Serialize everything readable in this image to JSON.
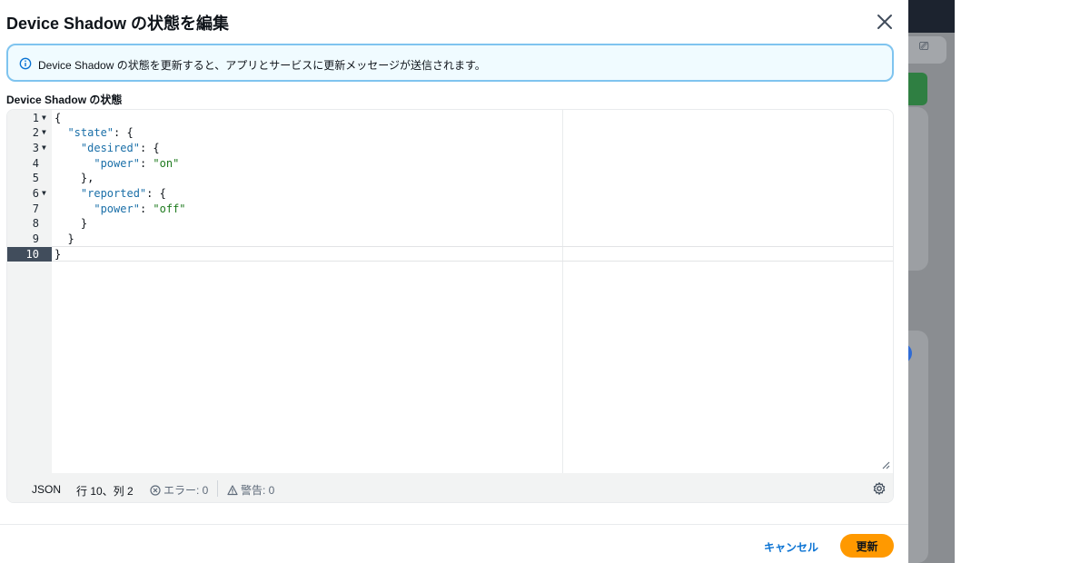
{
  "modal": {
    "title": "Device Shadow の状態を編集",
    "close_icon": "close-icon"
  },
  "alert": {
    "icon": "info-icon",
    "text": "Device Shadow の状態を更新すると、アプリとサービスに更新メッセージが送信されます。"
  },
  "editor": {
    "label": "Device Shadow の状態",
    "active_line": 10,
    "lines": [
      {
        "num": "1",
        "fold": true,
        "parts": [
          {
            "t": "{",
            "c": "punct"
          }
        ]
      },
      {
        "num": "2",
        "fold": true,
        "parts": [
          {
            "t": "  ",
            "c": "punct"
          },
          {
            "t": "\"state\"",
            "c": "key"
          },
          {
            "t": ": {",
            "c": "punct"
          }
        ]
      },
      {
        "num": "3",
        "fold": true,
        "parts": [
          {
            "t": "    ",
            "c": "punct"
          },
          {
            "t": "\"desired\"",
            "c": "key"
          },
          {
            "t": ": {",
            "c": "punct"
          }
        ]
      },
      {
        "num": "4",
        "fold": false,
        "parts": [
          {
            "t": "      ",
            "c": "punct"
          },
          {
            "t": "\"power\"",
            "c": "key"
          },
          {
            "t": ": ",
            "c": "punct"
          },
          {
            "t": "\"on\"",
            "c": "str"
          }
        ]
      },
      {
        "num": "5",
        "fold": false,
        "parts": [
          {
            "t": "    },",
            "c": "punct"
          }
        ]
      },
      {
        "num": "6",
        "fold": true,
        "parts": [
          {
            "t": "    ",
            "c": "punct"
          },
          {
            "t": "\"reported\"",
            "c": "key"
          },
          {
            "t": ": {",
            "c": "punct"
          }
        ]
      },
      {
        "num": "7",
        "fold": false,
        "parts": [
          {
            "t": "      ",
            "c": "punct"
          },
          {
            "t": "\"power\"",
            "c": "key"
          },
          {
            "t": ": ",
            "c": "punct"
          },
          {
            "t": "\"off\"",
            "c": "str"
          }
        ]
      },
      {
        "num": "8",
        "fold": false,
        "parts": [
          {
            "t": "    }",
            "c": "punct"
          }
        ]
      },
      {
        "num": "9",
        "fold": false,
        "parts": [
          {
            "t": "  }",
            "c": "punct"
          }
        ]
      },
      {
        "num": "10",
        "fold": false,
        "parts": [
          {
            "t": "}",
            "c": "punct"
          }
        ]
      }
    ],
    "fold_glyph": "▼"
  },
  "status": {
    "language": "JSON",
    "position": "行 10、列 2",
    "errors": "エラー: 0",
    "warnings": "警告: 0",
    "settings_icon": "gear-icon"
  },
  "footer": {
    "cancel_label": "キャンセル",
    "update_label": "更新"
  },
  "colors": {
    "accent": "#ff9900",
    "link": "#0972d3",
    "info_border": "#7fc4ef"
  }
}
